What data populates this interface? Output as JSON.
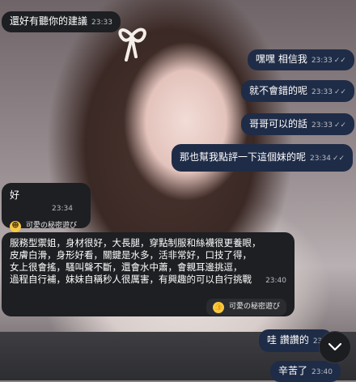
{
  "messages": [
    {
      "id": "m1",
      "side": "in",
      "text": "還好有聽你的建議",
      "time": "23:33"
    },
    {
      "id": "m2",
      "side": "out",
      "text": "嘿嘿 相信我",
      "time": "23:33",
      "ticks": "✓✓"
    },
    {
      "id": "m3",
      "side": "out",
      "text": "就不會錯的呢",
      "time": "23:33",
      "ticks": "✓✓"
    },
    {
      "id": "m4",
      "side": "out",
      "text": "哥哥可以的話",
      "time": "23:33",
      "ticks": "✓✓"
    },
    {
      "id": "m5",
      "side": "out",
      "text": "那也幫我點評一下這個妹的呢",
      "time": "23:34",
      "ticks": "✓✓"
    },
    {
      "id": "m6",
      "side": "in",
      "text": "好",
      "time": "23:34",
      "sticker": {
        "icon": "grinning-face-icon",
        "label": "可愛の秘密遊び"
      }
    },
    {
      "id": "m7",
      "side": "in",
      "text": "服務型禦姐，身材很好，大長腿，穿點制服和絲襪很更養眼，\n皮膚白滑，身形好看，關鍵是水多，活非常好，口技了得，\n女上很會搖，騷叫聲不斷，還會水中蕭，會親耳邊挑逗，\n過程自行補，妹妹自稱秒人很厲害，有興趣的可以自行挑戰",
      "time": "23:40",
      "sticker": {
        "icon": "thumbs-up-icon",
        "label": "可愛の秘密遊び"
      }
    },
    {
      "id": "m8",
      "side": "out",
      "text": "哇 讚讚的",
      "time": "23:"
    },
    {
      "id": "m9",
      "side": "out",
      "text": "辛苦了",
      "time": "23:40"
    }
  ],
  "colors": {
    "incoming_bubble": "#1d1f22",
    "outgoing_bubble": "#1f2c47",
    "timestamp": "#b7bcc4"
  },
  "scroll_button": {
    "icon": "chevron-down-icon"
  }
}
